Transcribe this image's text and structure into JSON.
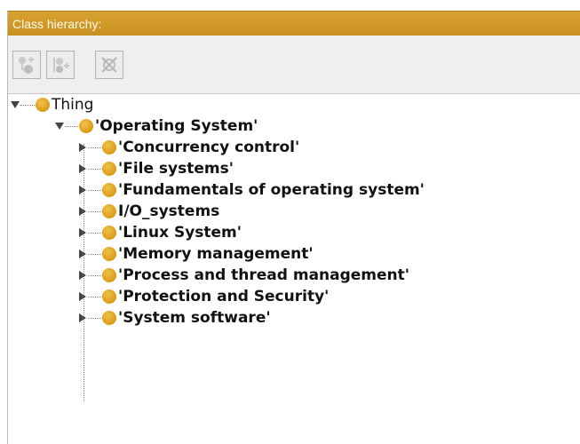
{
  "panel": {
    "title": "Class hierarchy:"
  },
  "toolbar": {
    "buttons": [
      {
        "name": "add-subclass-icon"
      },
      {
        "name": "add-sibling-class-icon"
      },
      {
        "name": "delete-class-icon"
      }
    ]
  },
  "tree": {
    "root": "Thing",
    "child": "'Operating System'",
    "items": [
      "'Concurrency control'",
      "'File systems'",
      "'Fundamentals of operating system'",
      "I/O_systems",
      "'Linux System'",
      "'Memory management'",
      "'Process and thread management'",
      "'Protection and Security'",
      "'System software'"
    ]
  },
  "colors": {
    "header": "#c8901f",
    "class_icon": "#e0a521"
  }
}
